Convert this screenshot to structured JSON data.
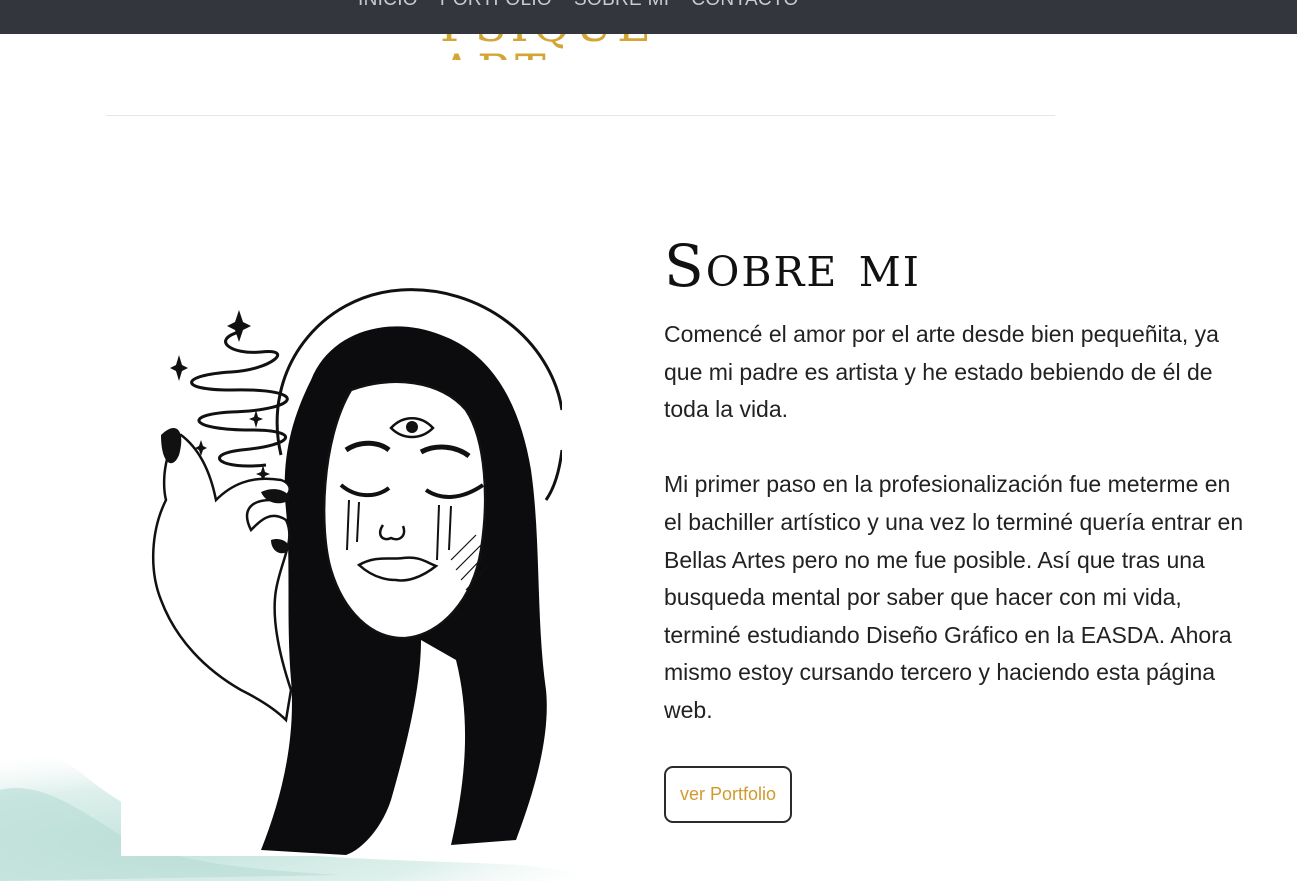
{
  "nav": {
    "items": [
      "INICIO",
      "PORTFOLIO",
      "SOBRE MI",
      "CONTACTO"
    ]
  },
  "logo": {
    "text": "PSIQUE ART"
  },
  "about": {
    "title": "Sobre mi",
    "paragraphs": [
      "Comencé el amor por el arte desde bien pequeñita, ya que mi padre es artista y he estado bebiendo de él de toda la vida.",
      "Mi primer paso en la profesionalización fue meterme en el bachiller artístico y una vez lo terminé quería entrar en Bellas Artes pero no me fue posible. Así que tras una busqueda mental por saber que hacer con mi vida, terminé estudiando Diseño Gráfico en la EASDA. Ahora mismo estoy cursando tercero y haciendo esta página web."
    ],
    "button_label": "ver Portfolio"
  },
  "colors": {
    "topbar": "#33363d",
    "gold": "#d3a535",
    "watercolor": "#bfe1da"
  }
}
